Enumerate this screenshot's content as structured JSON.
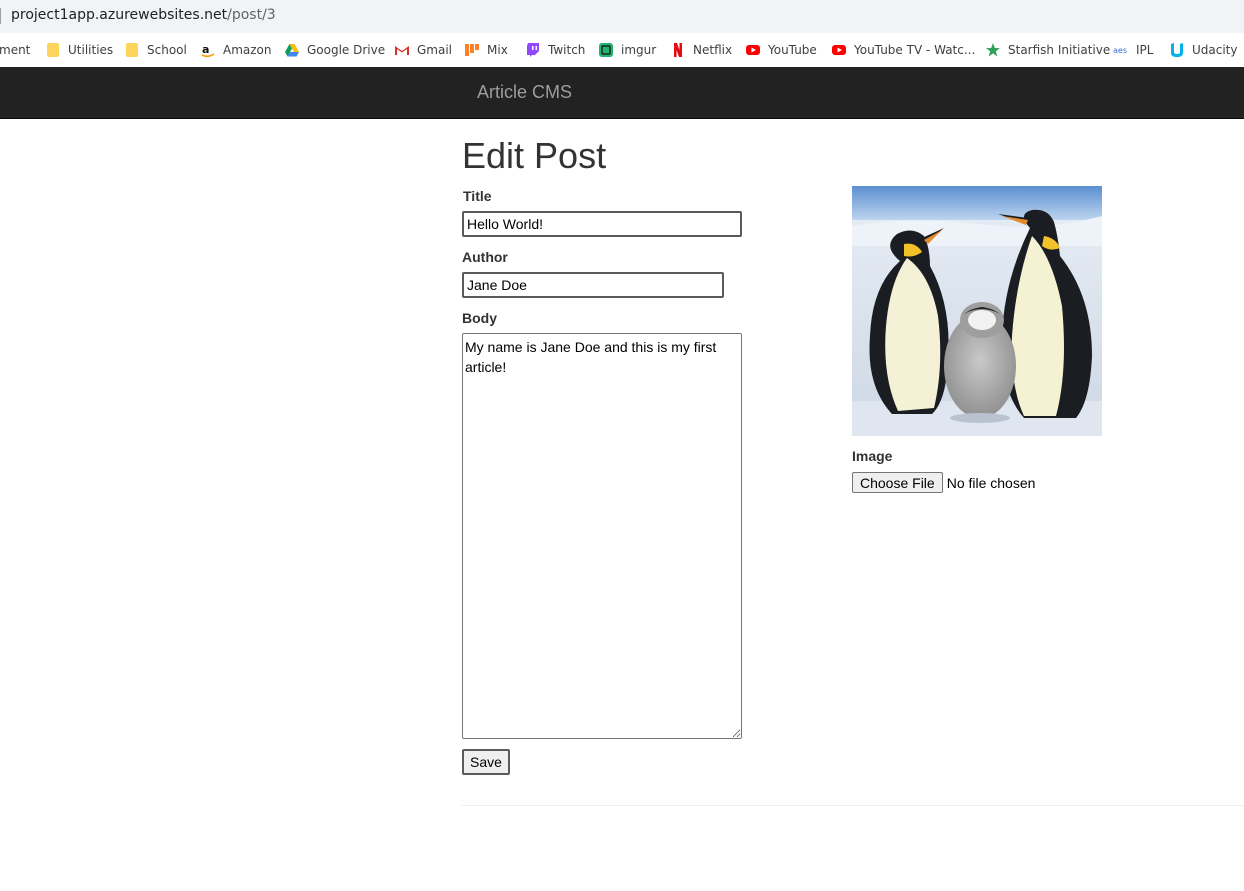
{
  "browser": {
    "url_host": "project1app.azurewebsites.net",
    "url_path": "/post/3"
  },
  "bookmarks": [
    {
      "label": "ment",
      "icon": "folder-icon"
    },
    {
      "label": "Utilities",
      "icon": "folder-icon"
    },
    {
      "label": "School",
      "icon": "folder-icon"
    },
    {
      "label": "Amazon",
      "icon": "amazon-icon"
    },
    {
      "label": "Google Drive",
      "icon": "google-drive-icon"
    },
    {
      "label": "Gmail",
      "icon": "gmail-icon"
    },
    {
      "label": "Mix",
      "icon": "mix-icon"
    },
    {
      "label": "Twitch",
      "icon": "twitch-icon"
    },
    {
      "label": "imgur",
      "icon": "imgur-icon"
    },
    {
      "label": "Netflix",
      "icon": "netflix-icon"
    },
    {
      "label": "YouTube",
      "icon": "youtube-icon"
    },
    {
      "label": "YouTube TV - Watc...",
      "icon": "youtube-icon"
    },
    {
      "label": "Starfish Initiative",
      "icon": "starfish-icon"
    },
    {
      "label": "IPL",
      "icon": "ipl-icon"
    },
    {
      "label": "Udacity",
      "icon": "udacity-icon"
    }
  ],
  "navbar": {
    "brand": "Article CMS"
  },
  "form": {
    "heading": "Edit Post",
    "title_label": "Title",
    "title_value": "Hello World!",
    "author_label": "Author",
    "author_value": "Jane Doe",
    "body_label": "Body",
    "body_value": "My name is Jane Doe and this is my first article!",
    "save_label": "Save",
    "image_label": "Image",
    "choose_file_label": "Choose File",
    "no_file_text": "No file chosen"
  },
  "colors": {
    "navbar_bg": "#222222",
    "brand_text": "#9d9d9d",
    "addressbar_bg": "#f1f3f4"
  }
}
